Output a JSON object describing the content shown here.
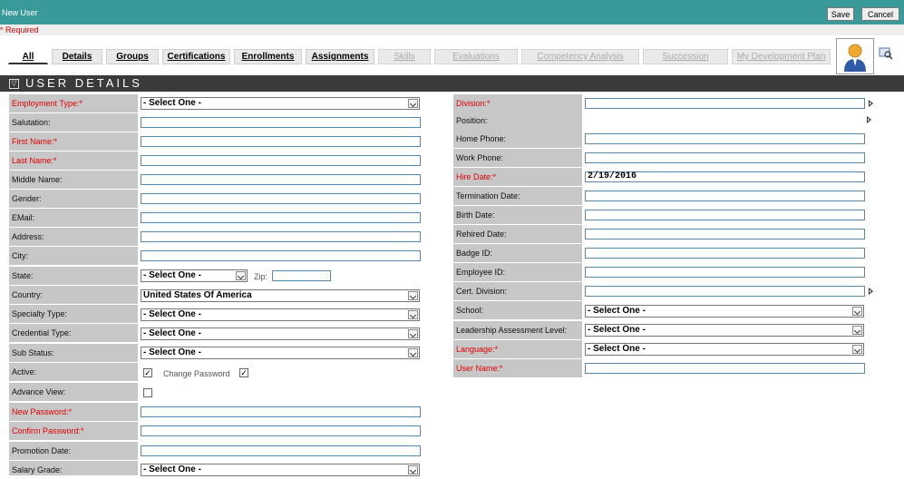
{
  "window": {
    "title": "New User"
  },
  "toolbar": {
    "save_label": "Save",
    "cancel_label": "Cancel"
  },
  "required_note": "* Required",
  "tabs": [
    {
      "label": "All",
      "state": "active"
    },
    {
      "label": "Details",
      "state": "enabled"
    },
    {
      "label": "Groups",
      "state": "enabled"
    },
    {
      "label": "Certifications",
      "state": "enabled"
    },
    {
      "label": "Enrollments",
      "state": "enabled"
    },
    {
      "label": "Assignments",
      "state": "enabled"
    },
    {
      "label": "Skills",
      "state": "disabled"
    },
    {
      "label": "Evaluations",
      "state": "disabled"
    },
    {
      "label": "Competency Analysis",
      "state": "disabled"
    },
    {
      "label": "Succession",
      "state": "disabled"
    },
    {
      "label": "My Development Plan",
      "state": "disabled"
    }
  ],
  "section": {
    "title": "USER DETAILS"
  },
  "left_fields": [
    {
      "label": "Employment Type:*",
      "value": "- Select One -"
    },
    {
      "label": "Salutation:",
      "value": ""
    },
    {
      "label": "First Name:*",
      "value": ""
    },
    {
      "label": "Last Name:*",
      "value": ""
    },
    {
      "label": "Middle Name:",
      "value": ""
    },
    {
      "label": "Gender:",
      "value": ""
    },
    {
      "label": "EMail:",
      "value": ""
    },
    {
      "label": "Address:",
      "value": ""
    },
    {
      "label": "City:",
      "value": ""
    },
    {
      "label": "State:",
      "value": "- Select One -"
    },
    {
      "label": "Country:",
      "value": "United States Of America"
    },
    {
      "label": "Specialty Type:",
      "value": "- Select One -"
    },
    {
      "label": "Credential Type:",
      "value": "- Select One -"
    },
    {
      "label": "Sub Status:",
      "value": "- Select One -"
    },
    {
      "label": "Active:",
      "value": "✓"
    },
    {
      "label": "Advance View:",
      "value": ""
    },
    {
      "label": "New Password:*",
      "value": ""
    },
    {
      "label": "Confirm Password:*",
      "value": ""
    },
    {
      "label": "Promotion Date:",
      "value": ""
    },
    {
      "label": "Salary Grade:",
      "value": "- Select One -"
    }
  ],
  "zip": {
    "label": "Zip:",
    "value": ""
  },
  "change_password": {
    "label": "Change Password",
    "checked": "✓"
  },
  "right_fields": [
    {
      "label": "Division:*",
      "value": ""
    },
    {
      "label": "Position:",
      "value": ""
    },
    {
      "label": "Home Phone:",
      "value": ""
    },
    {
      "label": "Work Phone:",
      "value": ""
    },
    {
      "label": "Hire Date:*",
      "value": "2/19/2016"
    },
    {
      "label": "Termination Date:",
      "value": ""
    },
    {
      "label": "Birth Date:",
      "value": ""
    },
    {
      "label": "Rehired Date:",
      "value": ""
    },
    {
      "label": "Badge ID:",
      "value": ""
    },
    {
      "label": "Employee ID:",
      "value": ""
    },
    {
      "label": "Cert. Division:",
      "value": ""
    },
    {
      "label": "School:",
      "value": "- Select One -"
    },
    {
      "label": "Leadership Assessment Level:",
      "value": "- Select One -"
    },
    {
      "label": "Language:*",
      "value": "- Select One -"
    },
    {
      "label": "User Name:*",
      "value": ""
    }
  ],
  "colors": {
    "header": "#3a9a9a",
    "section": "#3a3a3a",
    "required": "#e00000",
    "label_bg": "#c7c7c7"
  },
  "icons": {
    "user_photo": "user-avatar-icon",
    "upload": "picture-search-icon",
    "toggle": "collapse-triangle-icon",
    "picker": "picker-arrow-icon"
  }
}
